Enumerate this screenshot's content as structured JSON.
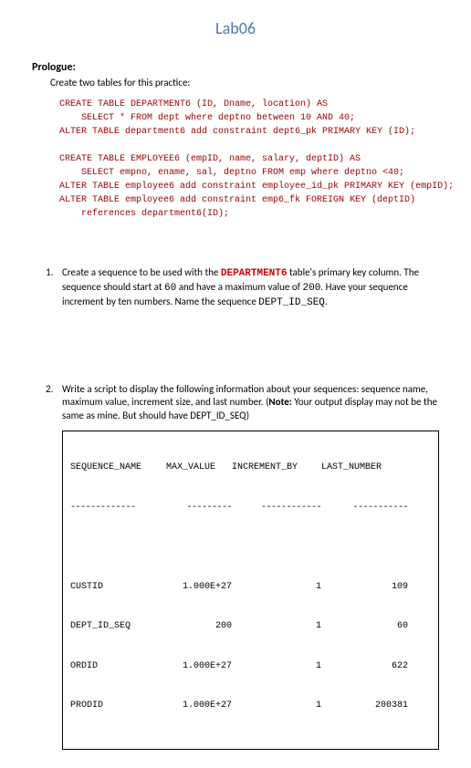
{
  "title": "Lab06",
  "prologue": {
    "heading": "Prologue:",
    "text": "Create two tables for this practice:"
  },
  "code": "CREATE TABLE DEPARTMENT6 (ID, Dname, location) AS\n    SELECT * FROM dept where deptno between 10 AND 40;\nALTER TABLE department6 add constraint dept6_pk PRIMARY KEY (ID);\n\nCREATE TABLE EMPLOYEE6 (empID, name, salary, deptID) AS\n    SELECT empno, ename, sal, deptno FROM emp where deptno <40;\nALTER TABLE employee6 add constraint employee_id_pk PRIMARY KEY (empID);\nALTER TABLE employee6 add constraint emp6_fk FOREIGN KEY (deptID)\n    references department6(ID);",
  "q1": {
    "num": "1.",
    "pre": "Create a sequence to be used with the ",
    "kw": "DEPARTMENT6",
    "post1": " table's primary key column. The sequence should start at ",
    "v1": "60",
    "post2": " and have a maximum value of ",
    "v2": "200",
    "post3": ". Have your sequence increment by ten numbers. Name the sequence ",
    "seqname": "DEPT_ID_SEQ",
    "post4": "."
  },
  "q2": {
    "num": "2.",
    "text1": "Write a script to display the following information about your sequences: sequence name, maximum value, increment size, and last number.  (",
    "notelabel": "Note:",
    "text2": " Your output display may not be the same as mine.  But should have DEPT_ID_SEQ)"
  },
  "table": {
    "h1": "SEQUENCE_NAME",
    "h2": "MAX_VALUE",
    "h3": "INCREMENT_BY",
    "h4": "LAST_NUMBER",
    "d1": "-------------",
    "d2": "---------",
    "d3": "------------",
    "d4": "-----------",
    "r1": {
      "c1": "CUSTID",
      "c2": "1.000E+27",
      "c3": "1",
      "c4": "109"
    },
    "r2": {
      "c1": "DEPT_ID_SEQ",
      "c2": "200",
      "c3": "1",
      "c4": "60"
    },
    "r3": {
      "c1": "ORDID",
      "c2": "1.000E+27",
      "c3": "1",
      "c4": "622"
    },
    "r4": {
      "c1": "PRODID",
      "c2": "1.000E+27",
      "c3": "1",
      "c4": "200381"
    }
  }
}
